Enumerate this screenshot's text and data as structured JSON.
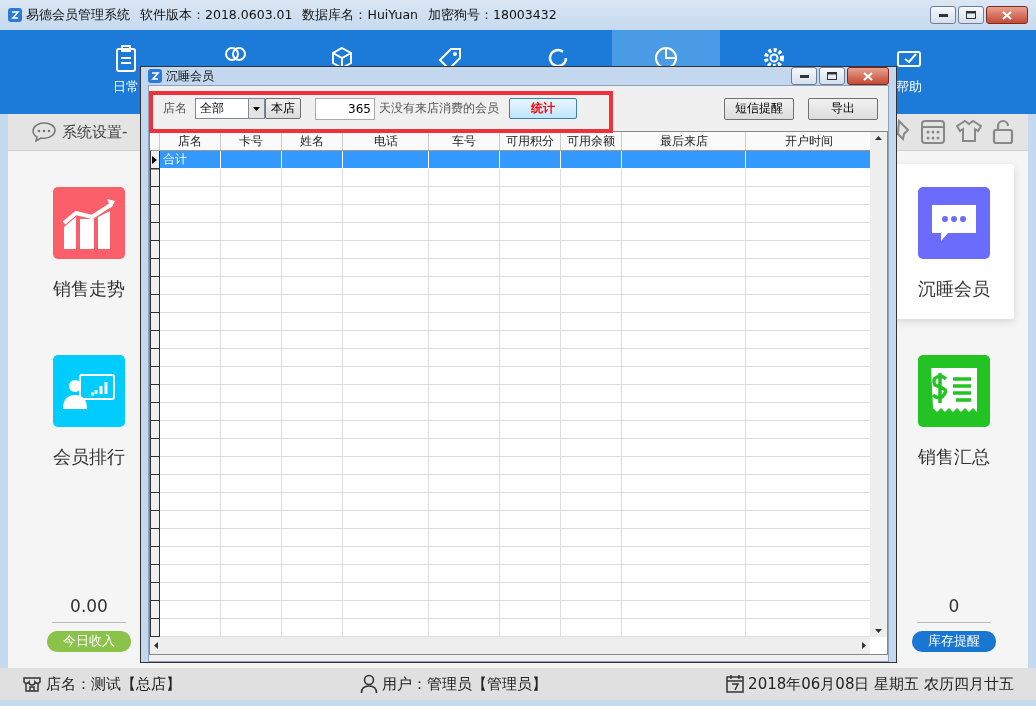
{
  "window": {
    "title_parts": [
      "易德会员管理系统",
      "软件版本：2018.0603.01",
      "数据库名：HuiYuan",
      "加密狗号：18003432"
    ]
  },
  "nav": [
    {
      "label": "日常",
      "selected": false
    },
    {
      "selected": false
    },
    {
      "selected": false
    },
    {
      "selected": false
    },
    {
      "selected": false
    },
    {
      "selected": true
    },
    {
      "selected": false
    },
    {
      "label": "帮助",
      "selected": false
    }
  ],
  "toolbar": {
    "breadcrumb": "系统设置-"
  },
  "left_tiles": [
    {
      "label": "销售走势"
    },
    {
      "label": "会员排行"
    }
  ],
  "right_tiles": [
    {
      "label": "沉睡会员",
      "selected": true
    },
    {
      "label": "销售汇总",
      "selected": false
    }
  ],
  "stats": [
    {
      "value": "0.00",
      "label": "今日收入",
      "color": "#8bc34a"
    },
    {
      "value": "0",
      "label": "库存提醒",
      "color": "#1976d2"
    }
  ],
  "status_bar": {
    "shop": "店名：测试【总店】",
    "user": "用户：管理员【管理员】",
    "date": "2018年06月08日 星期五 农历四月廿五"
  },
  "dialog": {
    "title": "沉睡会员",
    "filter": {
      "store_label": "店名",
      "store_value": "全部",
      "this_store_button": "本店",
      "days": "365",
      "days_suffix": "天没有来店消费的会员",
      "count_button": "统计"
    },
    "buttons": [
      "短信提醒",
      "导出"
    ],
    "table": {
      "columns": [
        "店名",
        "卡号",
        "姓名",
        "电话",
        "车号",
        "可用积分",
        "可用余额",
        "最后来店",
        "开户时间"
      ],
      "rows": [
        {
          "cells": [
            "合计",
            "",
            "",
            "",
            "",
            "",
            "",
            "",
            ""
          ],
          "selected": true
        }
      ]
    }
  }
}
